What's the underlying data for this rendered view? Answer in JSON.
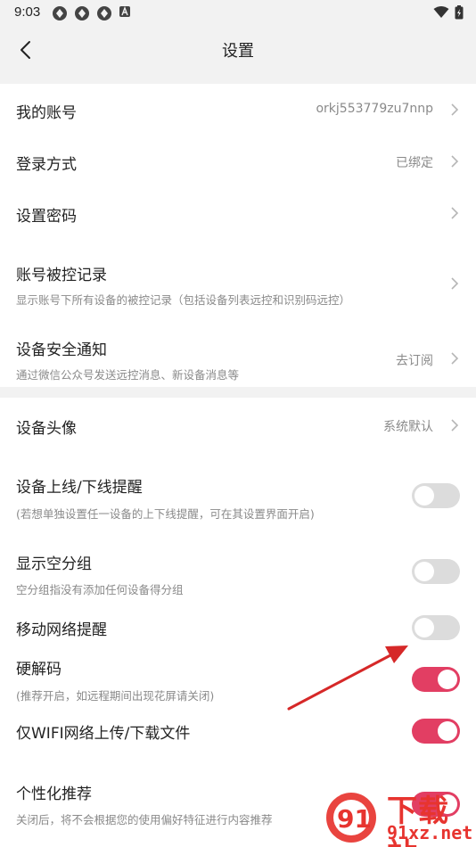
{
  "status_bar": {
    "time": "9:03"
  },
  "header": {
    "title": "设置"
  },
  "account_section": {
    "items": [
      {
        "label": "我的账号",
        "value": "orkj553779zu7nnp"
      },
      {
        "label": "登录方式",
        "value": "已绑定"
      },
      {
        "label": "设置密码",
        "value": ""
      },
      {
        "label": "账号被控记录",
        "sub": "显示账号下所有设备的被控记录（包括设备列表远控和识别码远控）"
      },
      {
        "label": "设备安全通知",
        "sub": "通过微信公众号发送远控消息、新设备消息等",
        "value": "去订阅"
      }
    ]
  },
  "device_section": {
    "avatar": {
      "label": "设备头像",
      "value": "系统默认"
    },
    "online_reminder": {
      "label": "设备上线/下线提醒",
      "sub": "(若想单独设置任一设备的上下线提醒，可在其设置界面开启)",
      "on": false
    },
    "show_empty_group": {
      "label": "显示空分组",
      "sub": "空分组指没有添加任何设备得分组",
      "on": false
    },
    "mobile_network": {
      "label": "移动网络提醒",
      "on": false
    },
    "hw_decode": {
      "label": "硬解码",
      "sub": "(推荐开启，如远程期间出现花屏请关闭)",
      "on": true
    },
    "wifi_only": {
      "label": "仅WIFI网络上传/下载文件",
      "on": true
    },
    "personalized": {
      "label": "个性化推荐",
      "sub": "关闭后，将不会根据您的使用偏好特征进行内容推荐",
      "on": true
    }
  },
  "watermark": {
    "title": "下载站",
    "url": "91xz.net"
  },
  "colors": {
    "accent": "#e23e63",
    "toggle_off": "#dcdcdc",
    "arrow": "#d62828"
  }
}
